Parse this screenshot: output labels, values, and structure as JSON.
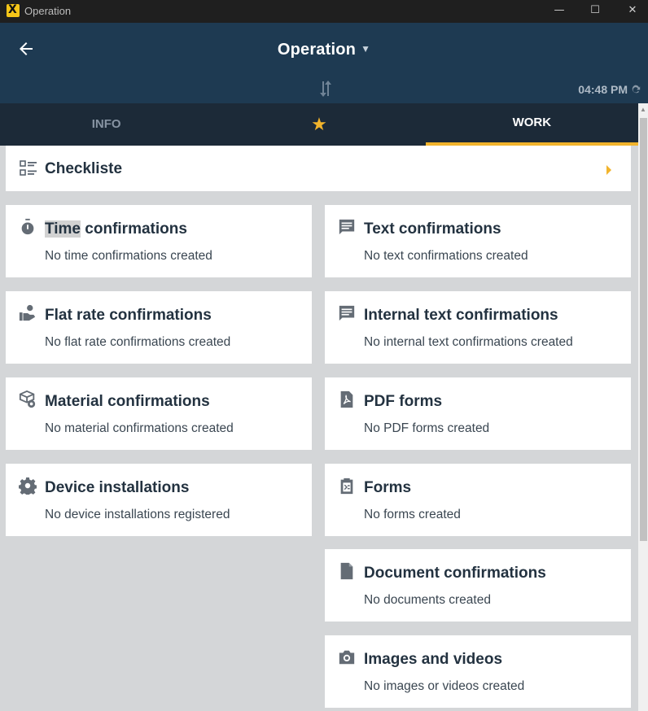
{
  "window": {
    "title": "Operation",
    "minimize": "—",
    "maximize": "☐",
    "close": "✕"
  },
  "header": {
    "title": "Operation",
    "time": "04:48 PM"
  },
  "tabs": [
    {
      "label": "INFO"
    },
    {
      "label": "★",
      "icon": "star-icon"
    },
    {
      "label": "WORK"
    }
  ],
  "checklist": {
    "label": "Checkliste"
  },
  "cards": {
    "time": {
      "title_highlight": "Time",
      "title_rest": " confirmations",
      "subtitle": "No time confirmations created",
      "icon": "stopwatch-icon"
    },
    "text": {
      "title": "Text confirmations",
      "subtitle": "No text confirmations created",
      "icon": "message-icon"
    },
    "flat_rate": {
      "title": "Flat rate confirmations",
      "subtitle": "No flat rate confirmations created",
      "icon": "hand-coins-icon"
    },
    "internal_text": {
      "title": "Internal text confirmations",
      "subtitle": "No internal text confirmations created",
      "icon": "message-icon"
    },
    "material": {
      "title": "Material confirmations",
      "subtitle": "No material confirmations created",
      "icon": "package-icon"
    },
    "pdf": {
      "title": "PDF forms",
      "subtitle": "No PDF forms created",
      "icon": "pdf-icon"
    },
    "device": {
      "title": "Device installations",
      "subtitle": "No device installations registered",
      "icon": "gear-icon"
    },
    "forms": {
      "title": "Forms",
      "subtitle": "No forms created",
      "icon": "clipboard-icon"
    },
    "documents": {
      "title": "Document confirmations",
      "subtitle": "No documents created",
      "icon": "document-icon"
    },
    "images": {
      "title": "Images and videos",
      "subtitle": "No images or videos created",
      "icon": "camera-icon"
    }
  },
  "colors": {
    "header_bg": "#1e3a52",
    "tabs_bg": "#1c2a38",
    "accent": "#f2b42c",
    "page_bg": "#d4d6d8"
  }
}
